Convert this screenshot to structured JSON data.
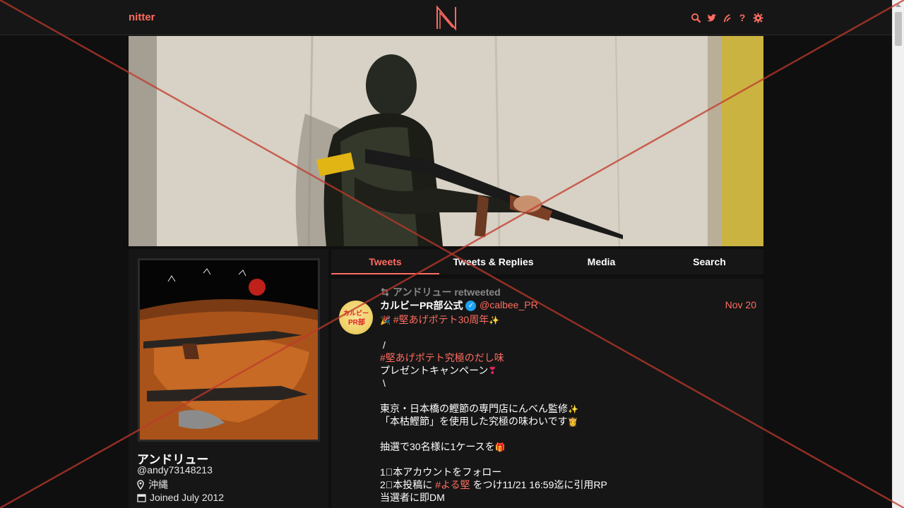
{
  "navbar": {
    "brand": "nitter",
    "logo_letter": "N",
    "icons": [
      "search-icon",
      "twitter-bird-icon",
      "rss-feed-icon",
      "help-icon",
      "gear-icon"
    ],
    "help_glyph": "?"
  },
  "colors": {
    "accent": "#ff6c60",
    "background": "#0f0f0f",
    "panel": "#161616",
    "overlay_x": "#c0392b"
  },
  "profile": {
    "fullname": "アンドリュー",
    "username": "@andy73148213",
    "location": "沖縄",
    "joined": "Joined July 2012"
  },
  "tabs": [
    {
      "label": "Tweets",
      "active": true
    },
    {
      "label": "Tweets & Replies",
      "active": false
    },
    {
      "label": "Media",
      "active": false
    },
    {
      "label": "Search",
      "active": false
    }
  ],
  "tweet": {
    "retweeted_by": "アンドリュー retweeted",
    "author_name": "カルビーPR部公式",
    "author_handle": "@calbee_PR",
    "date": "Nov 20",
    "avatar_text_1": "カルビー",
    "avatar_text_2": "PR部",
    "lines": {
      "l1_emoji": "🎉",
      "l1_hashtag": "#堅あげポテト30周年",
      "l1_emoji2": "✨",
      "l2": "/",
      "l3_hashtag": "#堅あげポテト究極のだし味",
      "l4": "プレゼントキャンペーン",
      "l4_emoji": "❣",
      "l5": "\\",
      "l6": "東京・日本橋の鰹節の専門店にんべん監修",
      "l6_emoji": "✨",
      "l7": "「本枯鰹節」を使用した究極の味わいです",
      "l7_emoji": "👸",
      "l8": "抽選で30名様に1ケースを",
      "l8_emoji": "🎁",
      "l9": "1⃣本アカウントをフォロー",
      "l10_pre": "2⃣本投稿に",
      "l10_hashtag": "#よる堅",
      "l10_post": "をつけ11/21 16:59迄に引用RP",
      "l11": "当選者に即DM"
    }
  }
}
